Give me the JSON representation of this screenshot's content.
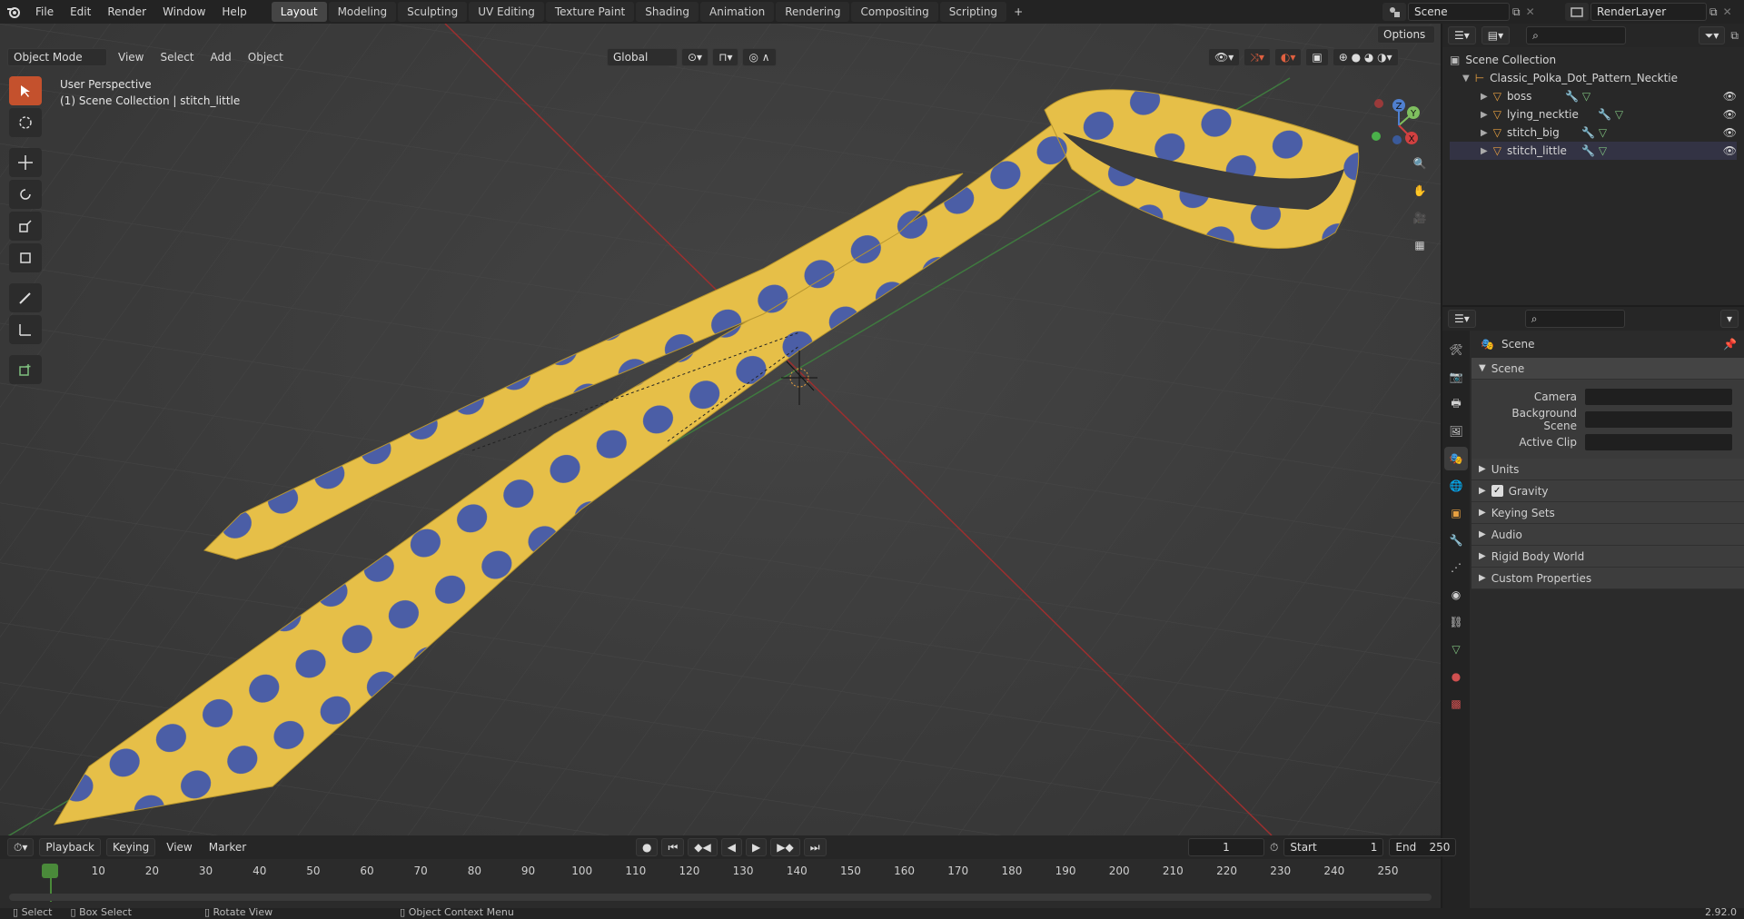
{
  "topbar": {
    "menus": [
      "File",
      "Edit",
      "Render",
      "Window",
      "Help"
    ],
    "workspaces": [
      "Layout",
      "Modeling",
      "Sculpting",
      "UV Editing",
      "Texture Paint",
      "Shading",
      "Animation",
      "Rendering",
      "Compositing",
      "Scripting"
    ],
    "active_workspace": "Layout",
    "add_tab": "+",
    "scene_name": "Scene",
    "render_layer": "RenderLayer"
  },
  "viewport": {
    "mode": "Object Mode",
    "menus": [
      "View",
      "Select",
      "Add",
      "Object"
    ],
    "transform_orientation": "Global",
    "options_label": "Options",
    "overlay_title": "User Perspective",
    "overlay_subtitle": "(1) Scene Collection | stitch_little",
    "gizmo_axes": [
      "Z",
      "Y",
      "X"
    ]
  },
  "outliner": {
    "root": "Scene Collection",
    "collection": "Classic_Polka_Dot_Pattern_Necktie",
    "objects": [
      "boss",
      "lying_necktie",
      "stitch_big",
      "stitch_little"
    ]
  },
  "properties": {
    "header": "Scene",
    "panel_title": "Scene",
    "fields": [
      {
        "label": "Camera",
        "value": ""
      },
      {
        "label": "Background Scene",
        "value": ""
      },
      {
        "label": "Active Clip",
        "value": ""
      }
    ],
    "subpanels": [
      "Units",
      "Gravity",
      "Keying Sets",
      "Audio",
      "Rigid Body World",
      "Custom Properties"
    ],
    "gravity_checked": true
  },
  "timeline": {
    "menus": [
      "Playback",
      "Keying",
      "View",
      "Marker"
    ],
    "current_frame": "1",
    "start_label": "Start",
    "start_value": "1",
    "end_label": "End",
    "end_value": "250",
    "ticks": [
      "1",
      "10",
      "20",
      "30",
      "40",
      "50",
      "60",
      "70",
      "80",
      "90",
      "100",
      "110",
      "120",
      "130",
      "140",
      "150",
      "160",
      "170",
      "180",
      "190",
      "200",
      "210",
      "220",
      "230",
      "240",
      "250"
    ]
  },
  "statusbar": {
    "select": "Select",
    "box_select": "Box Select",
    "rotate_view": "Rotate View",
    "context_menu": "Object Context Menu",
    "version": "2.92.0"
  },
  "colors": {
    "accent": "#c4512d",
    "tie_yellow": "#e8c14a",
    "dot_blue": "#4a5fa8",
    "axis_red": "#b03030",
    "axis_green": "#3e8a3e"
  }
}
